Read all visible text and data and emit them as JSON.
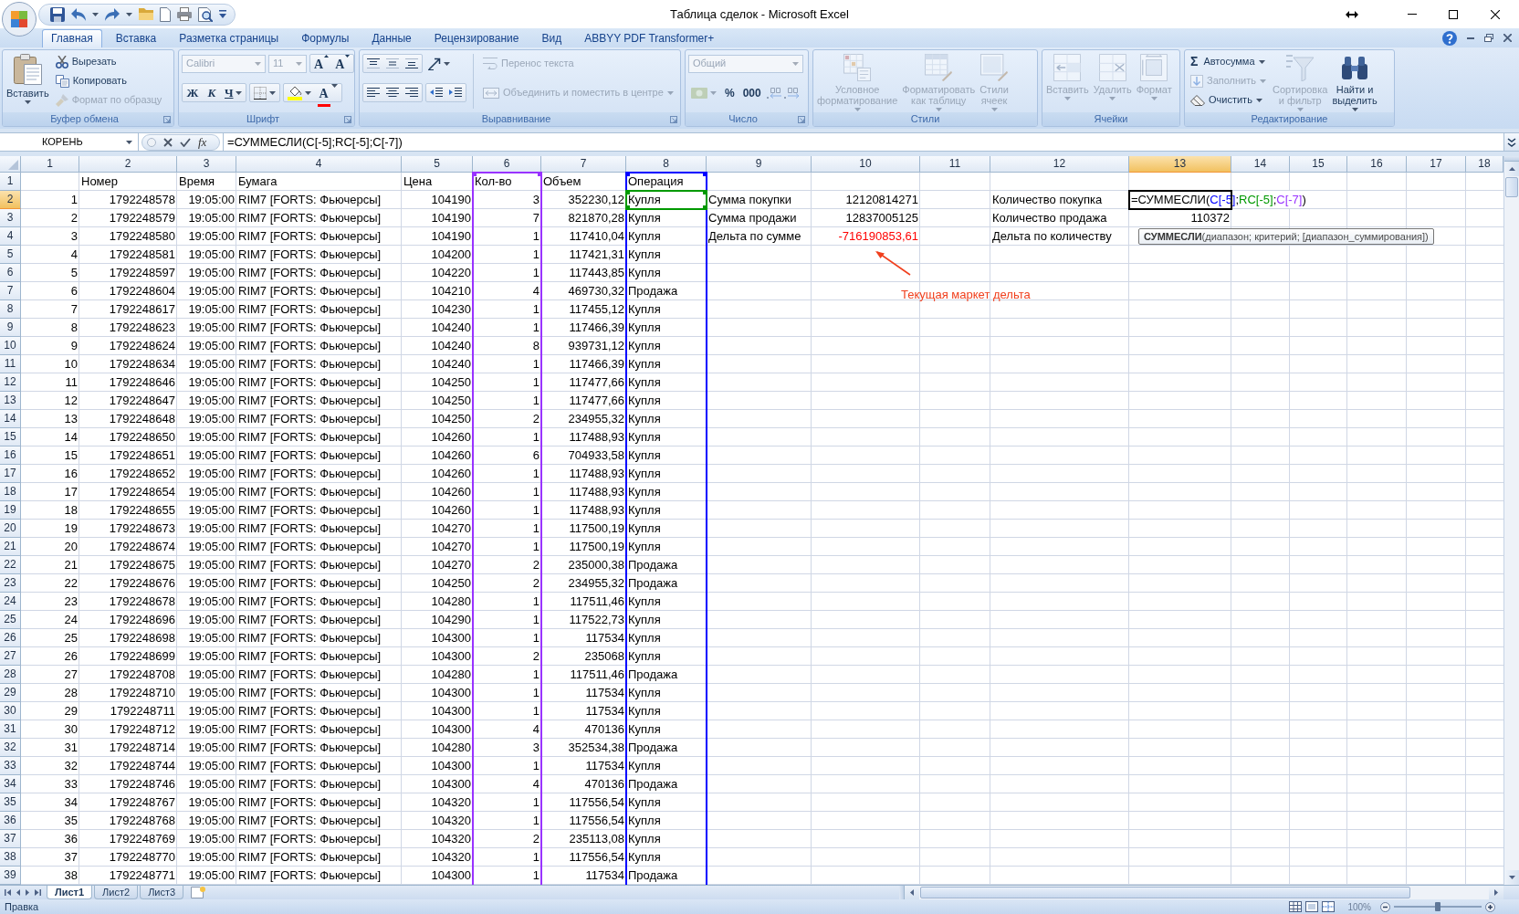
{
  "window": {
    "title": "Таблица сделок - Microsoft Excel"
  },
  "ribbon_tabs": [
    {
      "label": "Главная",
      "selected": true
    },
    {
      "label": "Вставка",
      "selected": false
    },
    {
      "label": "Разметка страницы",
      "selected": false
    },
    {
      "label": "Формулы",
      "selected": false
    },
    {
      "label": "Данные",
      "selected": false
    },
    {
      "label": "Рецензирование",
      "selected": false
    },
    {
      "label": "Вид",
      "selected": false
    },
    {
      "label": "ABBYY PDF Transformer+",
      "selected": false
    }
  ],
  "ribbon_groups": [
    {
      "kind": "clipboard",
      "title": "Буфер обмена",
      "paste": {
        "label": "Вставить"
      },
      "commands": [
        {
          "label": "Вырезать",
          "disabled": false
        },
        {
          "label": "Копировать",
          "disabled": false
        },
        {
          "label": "Формат по образцу",
          "disabled": true
        }
      ]
    },
    {
      "kind": "font",
      "title": "Шрифт",
      "font_name": {
        "value": "Calibri",
        "disabled": true
      },
      "font_size": {
        "value": "11",
        "disabled": true
      },
      "grow_label": "A",
      "shrink_label": "A",
      "bold": "Ж",
      "italic": "К",
      "underline": "Ч",
      "font_color_label": "A"
    },
    {
      "kind": "alignment",
      "title": "Выравнивание",
      "wrap": {
        "label": "Перенос текста",
        "disabled": true
      },
      "merge": {
        "label": "Объединить и поместить в центре",
        "disabled": true
      }
    },
    {
      "kind": "number",
      "title": "Число",
      "disabled": true,
      "format": {
        "value": "Общий"
      },
      "percent": "%",
      "thousands": "000"
    },
    {
      "kind": "large_buttons",
      "title": "Стили",
      "buttons": [
        {
          "label": "Условное форматирование",
          "disabled": true
        },
        {
          "label": "Форматировать как таблицу",
          "disabled": true
        },
        {
          "label": "Стили ячеек",
          "disabled": true
        }
      ]
    },
    {
      "kind": "large_buttons",
      "title": "Ячейки",
      "buttons": [
        {
          "label": "Вставить",
          "disabled": true
        },
        {
          "label": "Удалить",
          "disabled": true
        },
        {
          "label": "Формат",
          "disabled": true
        }
      ]
    },
    {
      "kind": "editing",
      "title": "Редактирование",
      "autosum": {
        "symbol": "Σ",
        "label": "Автосумма",
        "disabled": false
      },
      "fill": {
        "label": "Заполнить",
        "disabled": true
      },
      "clear": {
        "label": "Очистить",
        "disabled": false
      },
      "buttons": [
        {
          "label": "Сортировка и фильтр",
          "disabled": true
        },
        {
          "label": "Найти и выделить",
          "disabled": false
        }
      ]
    }
  ],
  "name_box": {
    "value": "КОРЕНЬ"
  },
  "formula_bar": {
    "insert_function": "fx",
    "value": "=СУММЕСЛИ(C[-5];RC[-5];C[-7])"
  },
  "sheet": {
    "columns": [
      {
        "label": "1",
        "selected": false
      },
      {
        "label": "2",
        "selected": false
      },
      {
        "label": "3",
        "selected": false
      },
      {
        "label": "4",
        "selected": false
      },
      {
        "label": "5",
        "selected": false
      },
      {
        "label": "6",
        "selected": false,
        "color": "#9933ff"
      },
      {
        "label": "7",
        "selected": false
      },
      {
        "label": "8",
        "selected": false,
        "color": "#0000ff"
      },
      {
        "label": "9",
        "selected": false
      },
      {
        "label": "10",
        "selected": false
      },
      {
        "label": "11",
        "selected": false
      },
      {
        "label": "12",
        "selected": false
      },
      {
        "label": "13",
        "selected": true
      },
      {
        "label": "14",
        "selected": false
      },
      {
        "label": "15",
        "selected": false
      },
      {
        "label": "16",
        "selected": false
      },
      {
        "label": "17",
        "selected": false
      },
      {
        "label": "18",
        "selected": false
      }
    ],
    "row_headers": [
      {
        "label": "1",
        "selected": false
      },
      {
        "label": "2",
        "selected": true
      },
      {
        "label": "3",
        "selected": false
      },
      {
        "label": "4",
        "selected": false
      },
      {
        "label": "5",
        "selected": false
      },
      {
        "label": "6",
        "selected": false
      },
      {
        "label": "7",
        "selected": false
      },
      {
        "label": "8",
        "selected": false
      },
      {
        "label": "9",
        "selected": false
      },
      {
        "label": "10",
        "selected": false
      },
      {
        "label": "11",
        "selected": false
      },
      {
        "label": "12",
        "selected": false
      },
      {
        "label": "13",
        "selected": false
      },
      {
        "label": "14",
        "selected": false
      },
      {
        "label": "15",
        "selected": false
      },
      {
        "label": "16",
        "selected": false
      },
      {
        "label": "17",
        "selected": false
      },
      {
        "label": "18",
        "selected": false
      },
      {
        "label": "19",
        "selected": false
      },
      {
        "label": "20",
        "selected": false
      },
      {
        "label": "21",
        "selected": false
      },
      {
        "label": "22",
        "selected": false
      },
      {
        "label": "23",
        "selected": false
      },
      {
        "label": "24",
        "selected": false
      },
      {
        "label": "25",
        "selected": false
      },
      {
        "label": "26",
        "selected": false
      },
      {
        "label": "27",
        "selected": false
      },
      {
        "label": "28",
        "selected": false
      },
      {
        "label": "29",
        "selected": false
      },
      {
        "label": "30",
        "selected": false
      },
      {
        "label": "31",
        "selected": false
      },
      {
        "label": "32",
        "selected": false
      },
      {
        "label": "33",
        "selected": false
      },
      {
        "label": "34",
        "selected": false
      },
      {
        "label": "35",
        "selected": false
      },
      {
        "label": "36",
        "selected": false
      },
      {
        "label": "37",
        "selected": false
      },
      {
        "label": "38",
        "selected": false
      },
      {
        "label": "39",
        "selected": false
      }
    ],
    "header_row": [
      "Номер",
      "Время",
      "Бумага",
      "Цена",
      "Кол-во",
      "Объем",
      "Операция"
    ],
    "trades": [
      [
        "1",
        "1792248578",
        "19:05:00",
        "RIM7 [FORTS: Фьючерсы]",
        "104190",
        "3",
        "352230,12",
        "Купля"
      ],
      [
        "2",
        "1792248579",
        "19:05:00",
        "RIM7 [FORTS: Фьючерсы]",
        "104190",
        "7",
        "821870,28",
        "Купля"
      ],
      [
        "3",
        "1792248580",
        "19:05:00",
        "RIM7 [FORTS: Фьючерсы]",
        "104190",
        "1",
        "117410,04",
        "Купля"
      ],
      [
        "4",
        "1792248581",
        "19:05:00",
        "RIM7 [FORTS: Фьючерсы]",
        "104200",
        "1",
        "117421,31",
        "Купля"
      ],
      [
        "5",
        "1792248597",
        "19:05:00",
        "RIM7 [FORTS: Фьючерсы]",
        "104220",
        "1",
        "117443,85",
        "Купля"
      ],
      [
        "6",
        "1792248604",
        "19:05:00",
        "RIM7 [FORTS: Фьючерсы]",
        "104210",
        "4",
        "469730,32",
        "Продажа"
      ],
      [
        "7",
        "1792248617",
        "19:05:00",
        "RIM7 [FORTS: Фьючерсы]",
        "104230",
        "1",
        "117455,12",
        "Купля"
      ],
      [
        "8",
        "1792248623",
        "19:05:00",
        "RIM7 [FORTS: Фьючерсы]",
        "104240",
        "1",
        "117466,39",
        "Купля"
      ],
      [
        "9",
        "1792248624",
        "19:05:00",
        "RIM7 [FORTS: Фьючерсы]",
        "104240",
        "8",
        "939731,12",
        "Купля"
      ],
      [
        "10",
        "1792248634",
        "19:05:00",
        "RIM7 [FORTS: Фьючерсы]",
        "104240",
        "1",
        "117466,39",
        "Купля"
      ],
      [
        "11",
        "1792248646",
        "19:05:00",
        "RIM7 [FORTS: Фьючерсы]",
        "104250",
        "1",
        "117477,66",
        "Купля"
      ],
      [
        "12",
        "1792248647",
        "19:05:00",
        "RIM7 [FORTS: Фьючерсы]",
        "104250",
        "1",
        "117477,66",
        "Купля"
      ],
      [
        "13",
        "1792248648",
        "19:05:00",
        "RIM7 [FORTS: Фьючерсы]",
        "104250",
        "2",
        "234955,32",
        "Купля"
      ],
      [
        "14",
        "1792248650",
        "19:05:00",
        "RIM7 [FORTS: Фьючерсы]",
        "104260",
        "1",
        "117488,93",
        "Купля"
      ],
      [
        "15",
        "1792248651",
        "19:05:00",
        "RIM7 [FORTS: Фьючерсы]",
        "104260",
        "6",
        "704933,58",
        "Купля"
      ],
      [
        "16",
        "1792248652",
        "19:05:00",
        "RIM7 [FORTS: Фьючерсы]",
        "104260",
        "1",
        "117488,93",
        "Купля"
      ],
      [
        "17",
        "1792248654",
        "19:05:00",
        "RIM7 [FORTS: Фьючерсы]",
        "104260",
        "1",
        "117488,93",
        "Купля"
      ],
      [
        "18",
        "1792248655",
        "19:05:00",
        "RIM7 [FORTS: Фьючерсы]",
        "104260",
        "1",
        "117488,93",
        "Купля"
      ],
      [
        "19",
        "1792248673",
        "19:05:00",
        "RIM7 [FORTS: Фьючерсы]",
        "104270",
        "1",
        "117500,19",
        "Купля"
      ],
      [
        "20",
        "1792248674",
        "19:05:00",
        "RIM7 [FORTS: Фьючерсы]",
        "104270",
        "1",
        "117500,19",
        "Купля"
      ],
      [
        "21",
        "1792248675",
        "19:05:00",
        "RIM7 [FORTS: Фьючерсы]",
        "104270",
        "2",
        "235000,38",
        "Продажа"
      ],
      [
        "22",
        "1792248676",
        "19:05:00",
        "RIM7 [FORTS: Фьючерсы]",
        "104250",
        "2",
        "234955,32",
        "Продажа"
      ],
      [
        "23",
        "1792248678",
        "19:05:00",
        "RIM7 [FORTS: Фьючерсы]",
        "104280",
        "1",
        "117511,46",
        "Купля"
      ],
      [
        "24",
        "1792248696",
        "19:05:00",
        "RIM7 [FORTS: Фьючерсы]",
        "104290",
        "1",
        "117522,73",
        "Купля"
      ],
      [
        "25",
        "1792248698",
        "19:05:00",
        "RIM7 [FORTS: Фьючерсы]",
        "104300",
        "1",
        "117534",
        "Купля"
      ],
      [
        "26",
        "1792248699",
        "19:05:00",
        "RIM7 [FORTS: Фьючерсы]",
        "104300",
        "2",
        "235068",
        "Купля"
      ],
      [
        "27",
        "1792248708",
        "19:05:00",
        "RIM7 [FORTS: Фьючерсы]",
        "104280",
        "1",
        "117511,46",
        "Продажа"
      ],
      [
        "28",
        "1792248710",
        "19:05:00",
        "RIM7 [FORTS: Фьючерсы]",
        "104300",
        "1",
        "117534",
        "Купля"
      ],
      [
        "29",
        "1792248711",
        "19:05:00",
        "RIM7 [FORTS: Фьючерсы]",
        "104300",
        "1",
        "117534",
        "Купля"
      ],
      [
        "30",
        "1792248712",
        "19:05:00",
        "RIM7 [FORTS: Фьючерсы]",
        "104300",
        "4",
        "470136",
        "Купля"
      ],
      [
        "31",
        "1792248714",
        "19:05:00",
        "RIM7 [FORTS: Фьючерсы]",
        "104280",
        "3",
        "352534,38",
        "Продажа"
      ],
      [
        "32",
        "1792248744",
        "19:05:00",
        "RIM7 [FORTS: Фьючерсы]",
        "104300",
        "1",
        "117534",
        "Купля"
      ],
      [
        "33",
        "1792248746",
        "19:05:00",
        "RIM7 [FORTS: Фьючерсы]",
        "104300",
        "4",
        "470136",
        "Продажа"
      ],
      [
        "34",
        "1792248767",
        "19:05:00",
        "RIM7 [FORTS: Фьючерсы]",
        "104320",
        "1",
        "117556,54",
        "Купля"
      ],
      [
        "35",
        "1792248768",
        "19:05:00",
        "RIM7 [FORTS: Фьючерсы]",
        "104320",
        "1",
        "117556,54",
        "Купля"
      ],
      [
        "36",
        "1792248769",
        "19:05:00",
        "RIM7 [FORTS: Фьючерсы]",
        "104320",
        "2",
        "235113,08",
        "Купля"
      ],
      [
        "37",
        "1792248770",
        "19:05:00",
        "RIM7 [FORTS: Фьючерсы]",
        "104320",
        "1",
        "117556,54",
        "Купля"
      ],
      [
        "38",
        "1792248771",
        "19:05:00",
        "RIM7 [FORTS: Фьючерсы]",
        "104300",
        "1",
        "117534",
        "Продажа"
      ]
    ],
    "sum_summary": [
      {
        "label": "Сумма покупки",
        "value": "12120814271",
        "negative": false
      },
      {
        "label": "Сумма продажи",
        "value": "12837005125",
        "negative": false
      },
      {
        "label": "Дельта по сумме",
        "value": "-716190853,61",
        "negative": true
      }
    ],
    "qty_summary": [
      {
        "label": "Количество покупка",
        "kind": "editing",
        "parts": [
          {
            "kind": "text",
            "text": "=СУММЕСЛИ("
          },
          {
            "kind": "column_ref",
            "text": "C[-5]",
            "color": "#0000ff"
          },
          {
            "kind": "text",
            "text": ";"
          },
          {
            "kind": "cell_ref",
            "text": "RC[-5]",
            "color": "#009900"
          },
          {
            "kind": "text",
            "text": ";"
          },
          {
            "kind": "column_ref",
            "text": "C[-7]",
            "color": "#9933ff"
          },
          {
            "kind": "text",
            "text": ")"
          }
        ]
      },
      {
        "label": "Количество продажа",
        "kind": "value",
        "value": "110372"
      },
      {
        "label": "Дельта по количеству",
        "kind": "empty"
      }
    ],
    "tooltip": {
      "text": "**СУММЕСЛИ**(диапазон; критерий; [диапазон_суммирования])"
    },
    "annotation": {
      "text": "Текущая маркет дельта"
    }
  },
  "sheet_tabs": [
    {
      "label": "Лист1",
      "selected": true
    },
    {
      "label": "Лист2",
      "selected": false
    },
    {
      "label": "Лист3",
      "selected": false
    }
  ],
  "status_bar": {
    "mode": "Правка",
    "zoom": "100%",
    "zoom_slider": {
      "level": 0.5
    }
  }
}
